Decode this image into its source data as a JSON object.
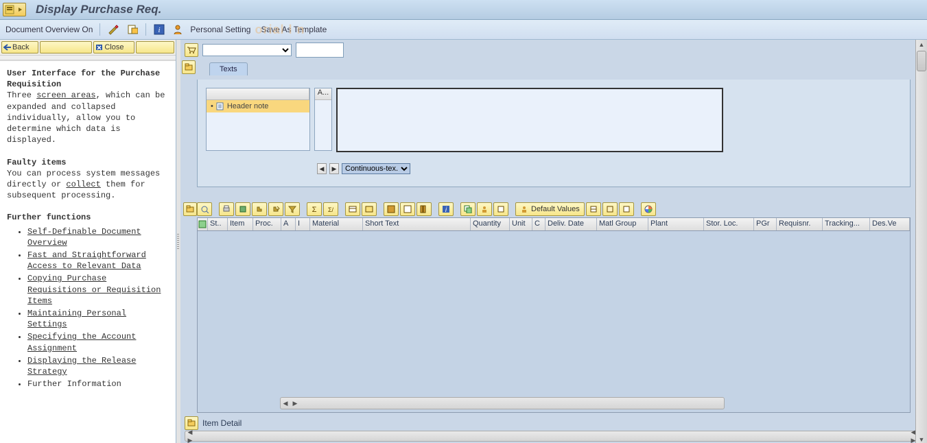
{
  "header": {
    "title": "Display Purchase Req."
  },
  "toolbar": {
    "doc_overview": "Document Overview On",
    "personal_setting": "Personal Setting",
    "save_as_template": "Save As Template",
    "watermark": "orial l n"
  },
  "help": {
    "back": " Back",
    "close": " Close",
    "h1": "User Interface for the Purchase Requisition",
    "p1a": "Three ",
    "p1b": "screen areas",
    "p1c": ", which can be expanded and collapsed individually, allow you to determine which data is displayed.",
    "h2": "Faulty items",
    "p2a": "You can process system messages directly or ",
    "p2b": "collect",
    "p2c": " them for subsequent processing.",
    "h3": "Further functions",
    "links": [
      "Self-Definable Document Overview",
      "Fast and Straightforward Access to Relevant Data",
      "Copying Purchase Requisitions or Requisition Items",
      "Maintaining Personal Settings",
      "Specifying the Account Assignment",
      "Displaying the Release Strategy",
      "Further Information"
    ]
  },
  "doc": {
    "type_value": "",
    "number_value": ""
  },
  "texts": {
    "tab": "Texts",
    "col_a": "A...",
    "header_note": "Header note",
    "format": "Continuous-tex.."
  },
  "grid": {
    "default_values": "Default Values",
    "columns": [
      "St..",
      "Item",
      "Proc.",
      "A",
      "I",
      "Material",
      "Short Text",
      "Quantity",
      "Unit",
      "C",
      "Deliv. Date",
      "Matl Group",
      "Plant",
      "Stor. Loc.",
      "PGr",
      "Requisnr.",
      "Tracking...",
      "Des.Ve"
    ]
  },
  "item_detail": {
    "label": "Item Detail"
  }
}
